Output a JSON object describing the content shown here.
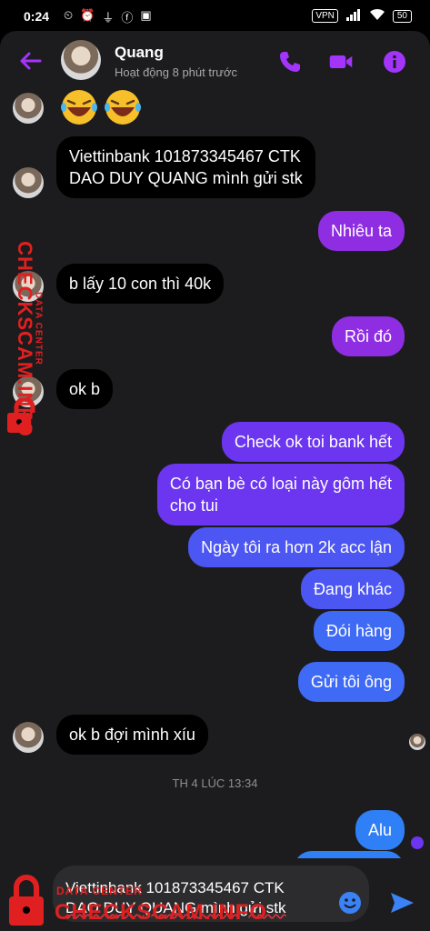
{
  "status_bar": {
    "time": "0:24",
    "vpn": "VPN",
    "battery": "50"
  },
  "header": {
    "name": "Quang",
    "status": "Hoạt động 8 phút trước"
  },
  "messages": {
    "m1": "Viettinbank 101873345467 CTK",
    "m1b": "DAO DUY QUANG mình gửi stk",
    "m2": "Nhiêu ta",
    "m3": "b lấy 10 con thì 40k",
    "m4": "Rồi đó",
    "m5": "ok b",
    "m6": "Check ok toi bank hết",
    "m7a": "Có bạn bè có loại này gôm hết",
    "m7b": "cho tui",
    "m8": "Ngày tôi ra hơn 2k acc lận",
    "m9": "Đang khác",
    "m10": "Đói hàng",
    "m11": "Gửi tôi ông",
    "m12": "ok b đợi mình xíu",
    "timestamp": "TH 4 LÚC 13:34",
    "m13": "Alu"
  },
  "composer": {
    "line1": "Viettinbank 101873345467 CTK",
    "line2": "DAO DUY QUANG mình gửi stk"
  },
  "watermark": {
    "brand": "CHECKSCAM.INFO",
    "sub": "DATA CENTER"
  },
  "colors": {
    "accent": "#a334fa",
    "bubble_purple": "#8e2de2",
    "bubble_blue": "#4c56f2"
  },
  "icons": [
    "back-arrow-icon",
    "phone-icon",
    "video-icon",
    "info-icon",
    "emoji-icon",
    "send-icon",
    "lock-icon",
    "laughing-emoji-icon"
  ]
}
